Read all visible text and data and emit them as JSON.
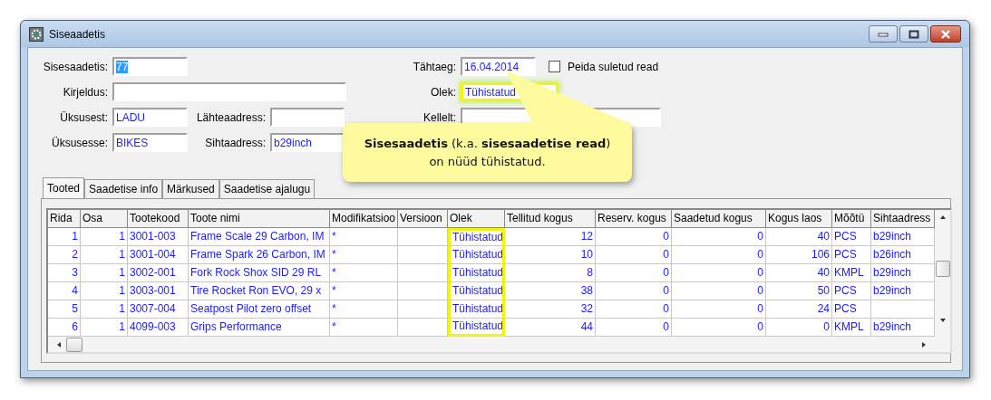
{
  "window": {
    "title": "Siseaadetis"
  },
  "form": {
    "left": [
      {
        "label": "Sisesaadetis:",
        "value": "77",
        "selected_text": true
      },
      {
        "label": "Kirjeldus:"
      },
      {
        "label": "Üksusest:",
        "value": "LADU",
        "second_label": "Lähteaadress:"
      },
      {
        "label": "Üksusesse:",
        "value": "BIKES",
        "second_label": "Sihtaadress:",
        "second_value": "b29inch"
      }
    ],
    "right": [
      {
        "kind": "checkbox",
        "label": "Tähtaeg:",
        "value": "16.04.2014",
        "highlighted": false,
        "checkbox": {
          "label": "Peida suletud read",
          "checked": false
        }
      },
      {
        "kind": "plain",
        "label": "Olek:",
        "value": "Tühistatud",
        "highlighted": true
      },
      {
        "kind": "double",
        "label": "Kellelt:",
        "highlighted": false
      }
    ]
  },
  "callout": {
    "lines": [
      "**Sisesaadetis** (k.a. **sisesaadetise read**)",
      "on nüüd tühistatud."
    ]
  },
  "tabs": [
    {
      "label": "Tooted",
      "selected": true
    },
    {
      "label": "Saadetise info",
      "selected": false
    },
    {
      "label": "Märkused",
      "selected": false
    },
    {
      "label": "Saadetise ajalugu",
      "selected": false
    }
  ],
  "table": {
    "columns": [
      {
        "label": "Rida",
        "highlighted": false
      },
      {
        "label": "Osa",
        "highlighted": false
      },
      {
        "label": "Tootekood",
        "highlighted": false
      },
      {
        "label": "Toote nimi",
        "highlighted": false
      },
      {
        "label": "Modifikatsioo",
        "highlighted": false
      },
      {
        "label": "Versioon",
        "highlighted": false
      },
      {
        "label": "Olek",
        "highlighted": true
      },
      {
        "label": "Tellitud kogus",
        "highlighted": false
      },
      {
        "label": "Reserv. kogus",
        "highlighted": false
      },
      {
        "label": "Saadetud kogus",
        "highlighted": false
      },
      {
        "label": "Kogus laos",
        "highlighted": false
      },
      {
        "label": "Mõõtü",
        "highlighted": false
      },
      {
        "label": "Sihtaadress",
        "highlighted": false
      }
    ],
    "rows": [
      [
        "1",
        "1",
        "3001-003",
        "Frame Scale 29 Carbon, IM",
        "*",
        "",
        "Tühistatud",
        "12",
        "0",
        "0",
        "40",
        "PCS",
        "b29inch"
      ],
      [
        "2",
        "1",
        "3001-004",
        "Frame Spark 26 Carbon, IM",
        "*",
        "",
        "Tühistatud",
        "10",
        "0",
        "0",
        "106",
        "PCS",
        "b26inch"
      ],
      [
        "3",
        "1",
        "3002-001",
        "Fork Rock Shox SID 29 RL",
        "*",
        "",
        "Tühistatud",
        "8",
        "0",
        "0",
        "40",
        "KMPL",
        "b29inch"
      ],
      [
        "4",
        "1",
        "3003-001",
        "Tire Rocket Ron EVO, 29 x",
        "*",
        "",
        "Tühistatud",
        "38",
        "0",
        "0",
        "50",
        "PCS",
        "b29inch"
      ],
      [
        "5",
        "1",
        "3007-004",
        "Seatpost Pilot zero offset",
        "*",
        "",
        "Tühistatud",
        "32",
        "0",
        "0",
        "24",
        "PCS",
        ""
      ],
      [
        "6",
        "1",
        "4099-003",
        "Grips Performance",
        "*",
        "",
        "Tühistatud",
        "44",
        "0",
        "0",
        "0",
        "KMPL",
        "b29inch"
      ]
    ]
  }
}
